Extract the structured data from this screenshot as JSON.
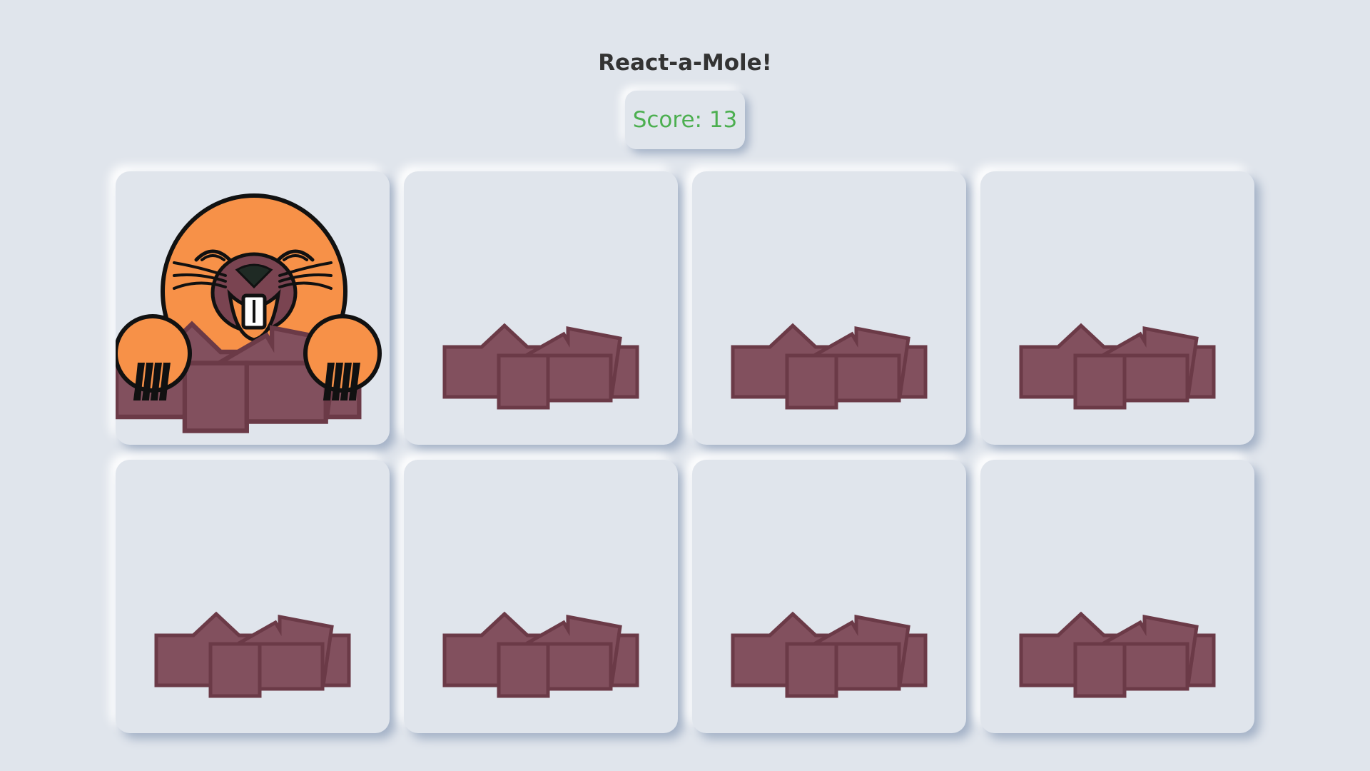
{
  "game": {
    "title": "React-a-Mole!",
    "score_label": "Score: 13",
    "score": 13
  },
  "colors": {
    "background": "#e0e5ec",
    "title": "#333333",
    "score": "#4caf50",
    "dirt": "#82505e",
    "dirt_outline": "#6b3a47",
    "mole": "#f79148"
  },
  "holes": [
    {
      "mole_visible": true
    },
    {
      "mole_visible": false
    },
    {
      "mole_visible": false
    },
    {
      "mole_visible": false
    },
    {
      "mole_visible": false
    },
    {
      "mole_visible": false
    },
    {
      "mole_visible": false
    },
    {
      "mole_visible": false
    }
  ]
}
